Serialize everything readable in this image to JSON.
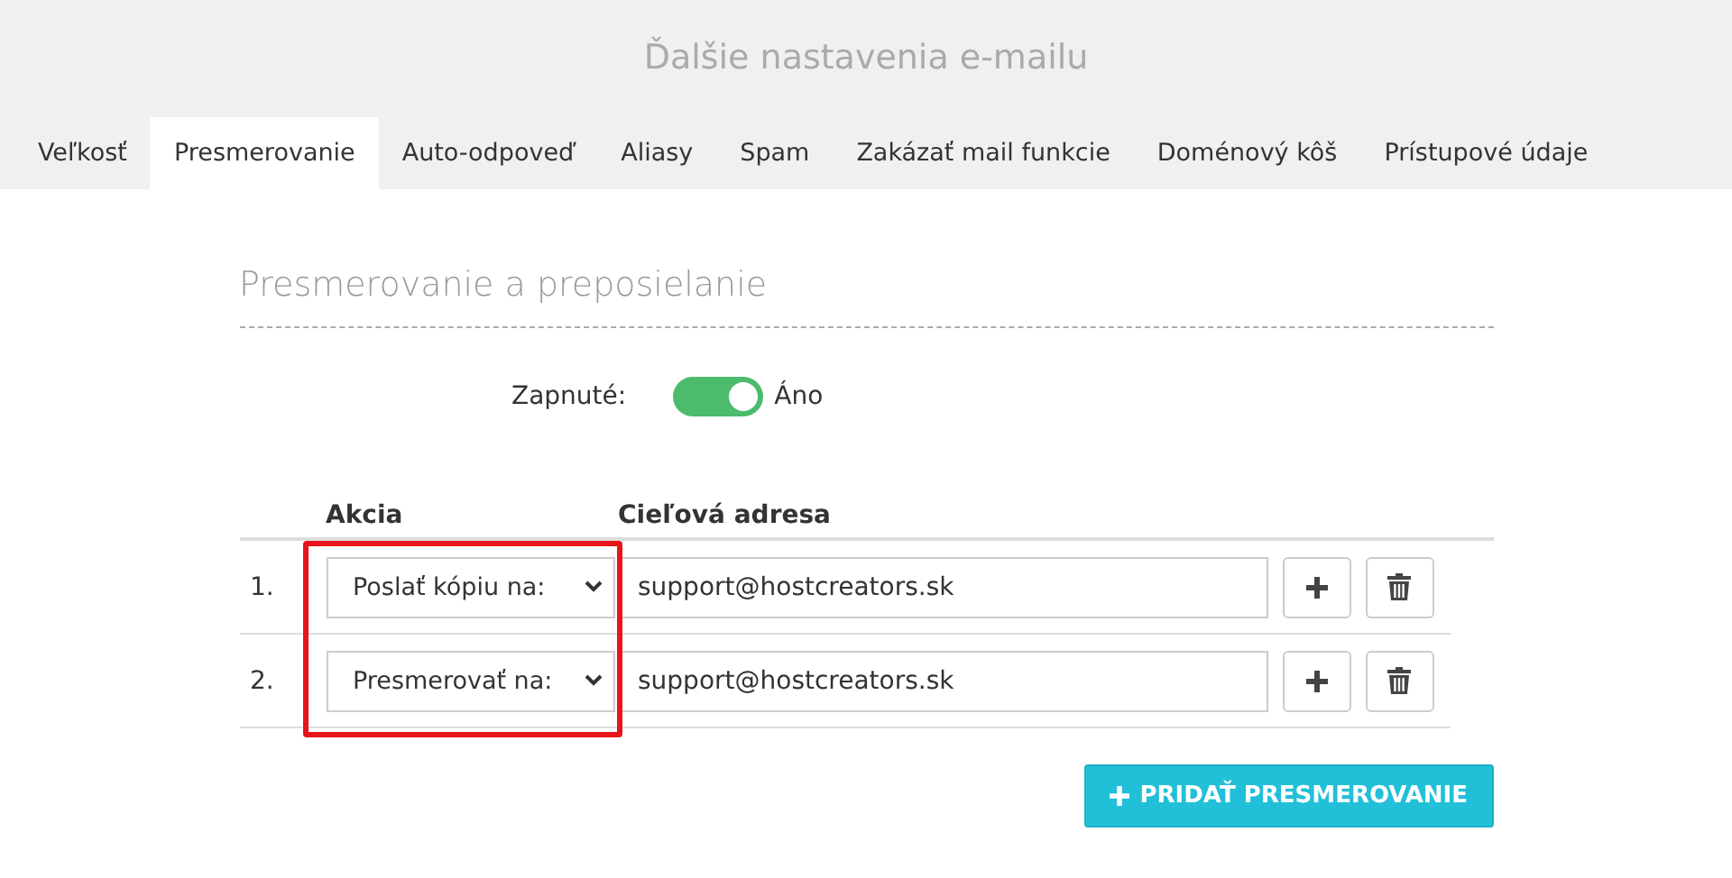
{
  "header": {
    "title": "Ďalšie nastavenia e-mailu"
  },
  "tabs": [
    {
      "label": "Veľkosť",
      "selected": false
    },
    {
      "label": "Presmerovanie",
      "selected": true
    },
    {
      "label": "Auto-odpoveď",
      "selected": false
    },
    {
      "label": "Aliasy",
      "selected": false
    },
    {
      "label": "Spam",
      "selected": false
    },
    {
      "label": "Zakázať mail funkcie",
      "selected": false
    },
    {
      "label": "Doménový kôš",
      "selected": false
    },
    {
      "label": "Prístupové údaje",
      "selected": false
    }
  ],
  "section": {
    "title": "Presmerovanie a preposielanie"
  },
  "toggle": {
    "label": "Zapnuté:",
    "on": true,
    "value_text": "Áno"
  },
  "table": {
    "columns": [
      "Akcia",
      "Cieľová adresa"
    ],
    "rows": [
      {
        "number": "1.",
        "action": "Poslať kópiu na:",
        "address": "support@hostcreators.sk"
      },
      {
        "number": "2.",
        "action": "Presmerovať na:",
        "address": "support@hostcreators.sk"
      }
    ]
  },
  "add_button": {
    "label": "PRIDAŤ PRESMEROVANIE"
  }
}
